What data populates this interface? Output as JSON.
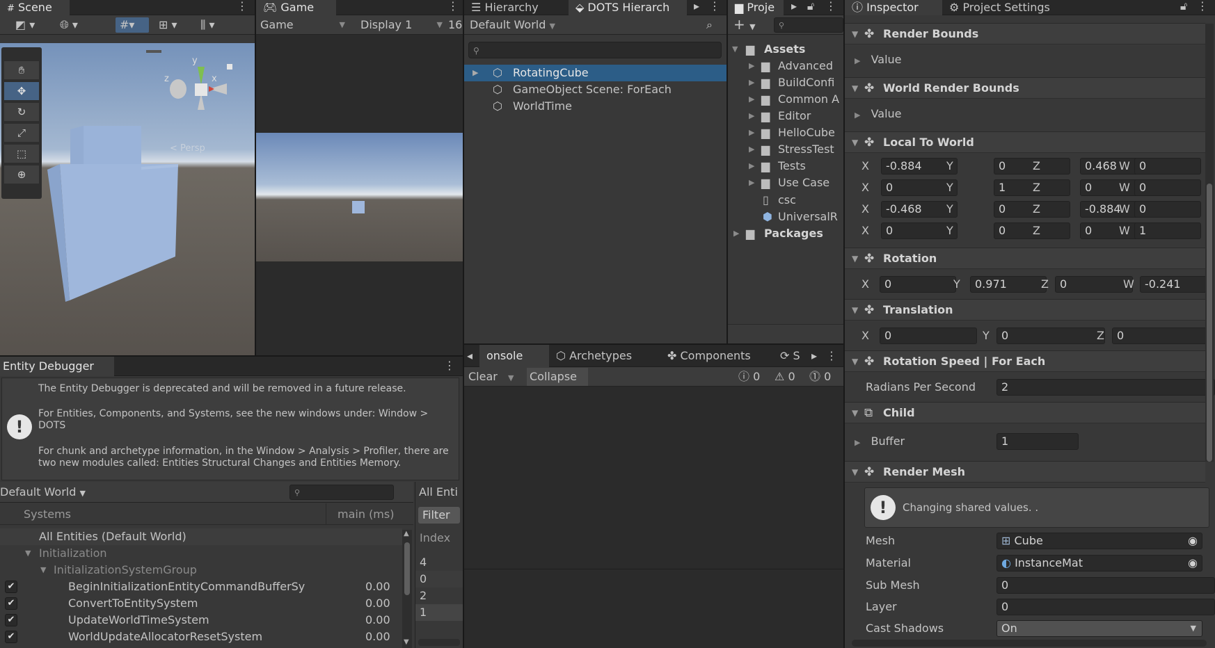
{
  "scene": {
    "tab": "Scene",
    "gizmo_axes": {
      "y": "y",
      "x": "x",
      "z": "z"
    },
    "persp_label": "< Persp"
  },
  "game": {
    "tab": "Game",
    "view_select": "Game",
    "display_select": "Display 1",
    "aspect": "16:"
  },
  "hierarchy": {
    "tabs": [
      "Hierarchy",
      "DOTS Hierarch"
    ],
    "world_select": "Default World",
    "items": [
      "RotatingCube",
      "GameObject Scene: ForEach",
      "WorldTime"
    ]
  },
  "project": {
    "tab": "Proje",
    "assets_label": "Assets",
    "folders": [
      "Advanced",
      "BuildConfi",
      "Common A",
      "Editor",
      "HelloCube",
      "StressTest",
      "Tests",
      "Use Case"
    ],
    "files": [
      "csc",
      "UniversalR"
    ],
    "packages_label": "Packages"
  },
  "inspector": {
    "tabs": [
      "Inspector",
      "Project Settings"
    ],
    "render_bounds": {
      "title": "Render Bounds",
      "value_label": "Value"
    },
    "world_render_bounds": {
      "title": "World Render Bounds",
      "value_label": "Value"
    },
    "local_to_world": {
      "title": "Local To World",
      "axis_labels": [
        "X",
        "Y",
        "Z",
        "W"
      ],
      "rows": [
        [
          "-0.884",
          "0",
          "0.468",
          "0"
        ],
        [
          "0",
          "1",
          "0",
          "0"
        ],
        [
          "-0.468",
          "0",
          "-0.884",
          "0"
        ],
        [
          "0",
          "0",
          "0",
          "1"
        ]
      ]
    },
    "rotation": {
      "title": "Rotation",
      "values": [
        "0",
        "0.971",
        "0",
        "-0.241"
      ]
    },
    "translation": {
      "title": "Translation",
      "values": [
        "0",
        "0",
        "0"
      ]
    },
    "rotation_speed": {
      "title": "Rotation Speed | For Each",
      "label": "Radians Per Second",
      "value": "2"
    },
    "child": {
      "title": "Child",
      "label": "Buffer",
      "value": "1"
    },
    "render_mesh": {
      "title": "Render Mesh",
      "notice": "Changing shared values.  .",
      "mesh_label": "Mesh",
      "mesh_value": "Cube",
      "material_label": "Material",
      "material_value": "InstanceMat",
      "submesh_label": "Sub Mesh",
      "submesh_value": "0",
      "layer_label": "Layer",
      "layer_value": "0",
      "cast_shadows_label": "Cast Shadows",
      "cast_shadows_value": "On"
    }
  },
  "console": {
    "tabs": [
      "onsole",
      "Archetypes",
      "Components",
      "S"
    ],
    "clear": "Clear",
    "collapse": "Collapse",
    "counts": [
      "0",
      "0",
      "0"
    ]
  },
  "entity_debugger": {
    "tab": "Entity Debugger",
    "messages": [
      "The Entity Debugger is deprecated and will be removed in a future release.",
      "For Entities, Components, and Systems, see the new windows under: Window > DOTS",
      "For chunk and archetype information, in the Window > Analysis > Profiler, there are two new modules called: Entities Structural Changes and Entities Memory."
    ],
    "world_select": "Default World",
    "columns": {
      "systems": "Systems",
      "main": "main (ms)"
    },
    "all_entities": "All Entities (Default World)",
    "group1": "Initialization",
    "group2": "InitializationSystemGroup",
    "systems": [
      {
        "name": "BeginInitializationEntityCommandBufferSy",
        "ms": "0.00"
      },
      {
        "name": "ConvertToEntitySystem",
        "ms": "0.00"
      },
      {
        "name": "UpdateWorldTimeSystem",
        "ms": "0.00"
      },
      {
        "name": "WorldUpdateAllocatorResetSystem",
        "ms": "0.00"
      }
    ],
    "entities_header": "All Enti",
    "filter": "Filter",
    "index_header": "Index",
    "indices": [
      "4",
      "0",
      "2",
      "1"
    ]
  },
  "colors": {
    "selection": "#2c5d87",
    "accent": "#4a7fb5"
  }
}
